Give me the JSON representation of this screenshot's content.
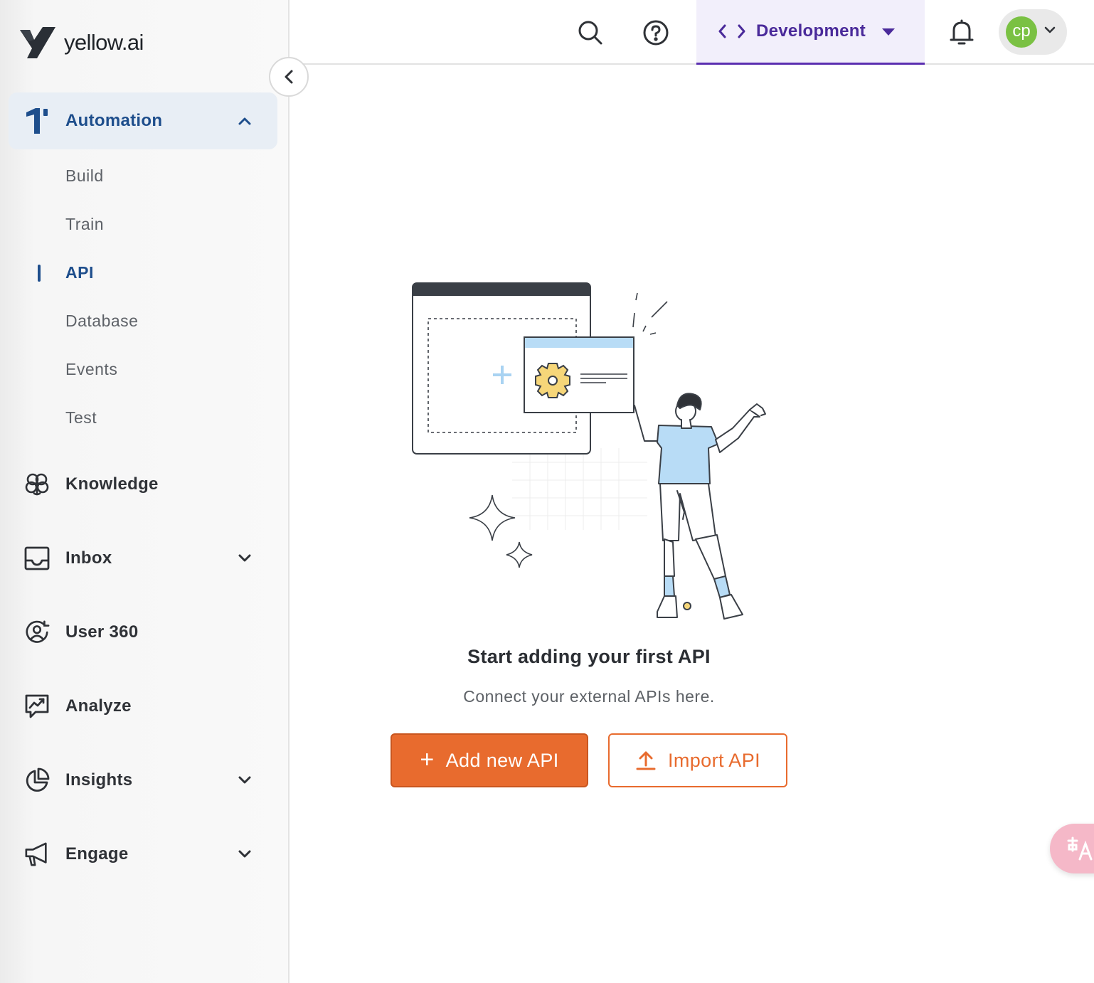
{
  "brand": {
    "name": "yellow.ai"
  },
  "sidebar": {
    "sections": [
      {
        "label": "Automation",
        "icon": "automation-icon",
        "expanded": true,
        "active": true
      },
      {
        "label": "Knowledge",
        "icon": "brain-icon"
      },
      {
        "label": "Inbox",
        "icon": "inbox-icon",
        "has_children": true
      },
      {
        "label": "User 360",
        "icon": "user-circle-icon"
      },
      {
        "label": "Analyze",
        "icon": "chart-icon"
      },
      {
        "label": "Insights",
        "icon": "pie-chart-icon",
        "has_children": true
      },
      {
        "label": "Engage",
        "icon": "megaphone-icon",
        "has_children": true
      }
    ],
    "automation_items": [
      "Build",
      "Train",
      "API",
      "Database",
      "Events",
      "Test"
    ],
    "active_item": "API"
  },
  "topbar": {
    "environment": "Development",
    "user_initials": "cp"
  },
  "empty_state": {
    "title": "Start adding your first API",
    "subtitle": "Connect your external APIs here.",
    "primary_button": "Add new API",
    "secondary_button": "Import API"
  },
  "colors": {
    "accent": "#e86b2e",
    "nav_active": "#1e4e8c",
    "env": "#5b2fb0",
    "avatar": "#7ac143"
  }
}
